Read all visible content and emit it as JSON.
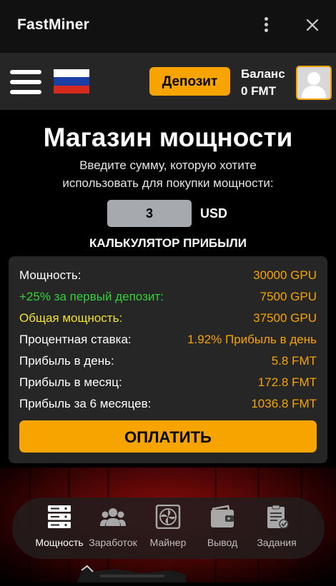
{
  "app": {
    "title": "FastMiner"
  },
  "header": {
    "deposit_label": "Депозит",
    "balance_label": "Баланс",
    "balance_value": "0 FMT",
    "flag": "russia-flag-icon"
  },
  "main": {
    "title": "Магазин мощности",
    "subtitle": "Введите сумму, которую хотите использовать для покупки мощности:",
    "amount_value": "3",
    "currency": "USD",
    "calculator_title": "КАЛЬКУЛЯТОР ПРИБЫЛИ"
  },
  "calculator": {
    "rows": [
      {
        "label": "Мощность:",
        "value": "30000 GPU",
        "label_color": "#ffffff"
      },
      {
        "label": "+25% за первый депозит:",
        "value": "7500 GPU",
        "label_color": "#34d13a"
      },
      {
        "label": "Общая мощность:",
        "value": "37500 GPU",
        "label_color": "#f1e22a"
      },
      {
        "label": "Процентная ставка:",
        "value": "1.92% Прибыль в день",
        "label_color": "#ffffff"
      },
      {
        "label": "Прибыль в день:",
        "value": "5.8 FMT",
        "label_color": "#ffffff"
      },
      {
        "label": "Прибыль в месяц:",
        "value": "172.8 FMT",
        "label_color": "#ffffff"
      },
      {
        "label": "Прибыль за 6 месяцев:",
        "value": "1036.8 FMT",
        "label_color": "#ffffff"
      }
    ],
    "pay_label": "ОПЛАТИТЬ"
  },
  "bottom_nav": {
    "items": [
      {
        "label": "Мощность",
        "icon": "server-icon",
        "active": true
      },
      {
        "label": "Заработок",
        "icon": "users-icon",
        "active": false
      },
      {
        "label": "Майнер",
        "icon": "fan-icon",
        "active": false
      },
      {
        "label": "Вывод",
        "icon": "wallet-icon",
        "active": false
      },
      {
        "label": "Задания",
        "icon": "tasks-icon",
        "active": false
      }
    ]
  },
  "colors": {
    "accent": "#f7a400",
    "bonus_green": "#34d13a",
    "total_yellow": "#f1e22a",
    "card_bg": "#262626"
  }
}
